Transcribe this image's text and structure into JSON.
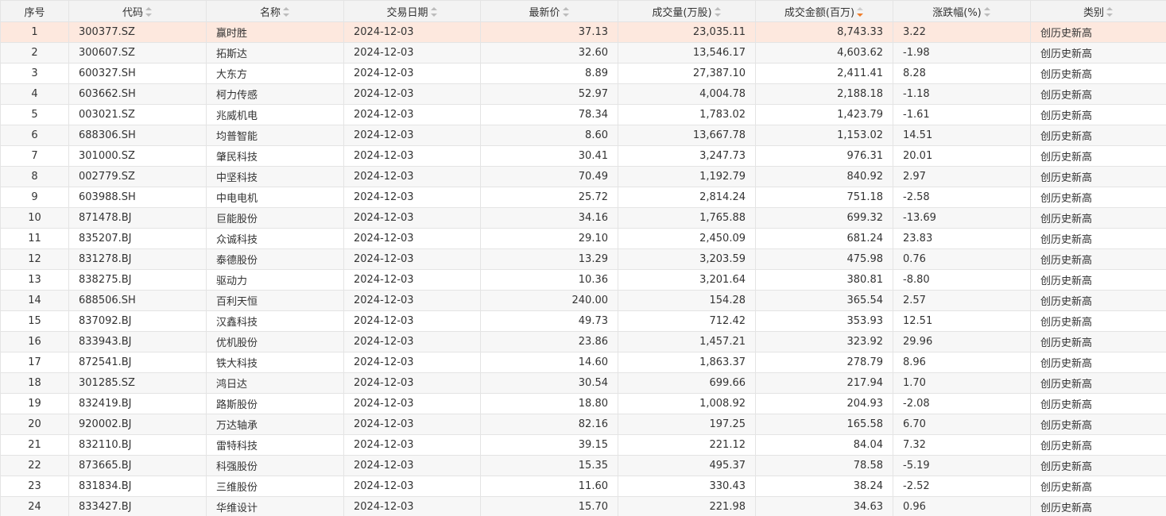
{
  "table": {
    "headers": {
      "seq": "序号",
      "code": "代码",
      "name": "名称",
      "date": "交易日期",
      "price": "最新价",
      "volume": "成交量(万股)",
      "amount": "成交金额(百万)",
      "pct": "涨跌幅(%)",
      "category": "类别"
    },
    "sort": {
      "column": "amount",
      "direction": "desc",
      "active_color": "#f07d2b"
    },
    "selected_row": 0,
    "rows": [
      [
        "1",
        "300377.SZ",
        "赢时胜",
        "2024-12-03",
        "37.13",
        "23,035.11",
        "8,743.33",
        "3.22",
        "创历史新高"
      ],
      [
        "2",
        "300607.SZ",
        "拓斯达",
        "2024-12-03",
        "32.60",
        "13,546.17",
        "4,603.62",
        "-1.98",
        "创历史新高"
      ],
      [
        "3",
        "600327.SH",
        "大东方",
        "2024-12-03",
        "8.89",
        "27,387.10",
        "2,411.41",
        "8.28",
        "创历史新高"
      ],
      [
        "4",
        "603662.SH",
        "柯力传感",
        "2024-12-03",
        "52.97",
        "4,004.78",
        "2,188.18",
        "-1.18",
        "创历史新高"
      ],
      [
        "5",
        "003021.SZ",
        "兆威机电",
        "2024-12-03",
        "78.34",
        "1,783.02",
        "1,423.79",
        "-1.61",
        "创历史新高"
      ],
      [
        "6",
        "688306.SH",
        "均普智能",
        "2024-12-03",
        "8.60",
        "13,667.78",
        "1,153.02",
        "14.51",
        "创历史新高"
      ],
      [
        "7",
        "301000.SZ",
        "肇民科技",
        "2024-12-03",
        "30.41",
        "3,247.73",
        "976.31",
        "20.01",
        "创历史新高"
      ],
      [
        "8",
        "002779.SZ",
        "中坚科技",
        "2024-12-03",
        "70.49",
        "1,192.79",
        "840.92",
        "2.97",
        "创历史新高"
      ],
      [
        "9",
        "603988.SH",
        "中电电机",
        "2024-12-03",
        "25.72",
        "2,814.24",
        "751.18",
        "-2.58",
        "创历史新高"
      ],
      [
        "10",
        "871478.BJ",
        "巨能股份",
        "2024-12-03",
        "34.16",
        "1,765.88",
        "699.32",
        "-13.69",
        "创历史新高"
      ],
      [
        "11",
        "835207.BJ",
        "众诚科技",
        "2024-12-03",
        "29.10",
        "2,450.09",
        "681.24",
        "23.83",
        "创历史新高"
      ],
      [
        "12",
        "831278.BJ",
        "泰德股份",
        "2024-12-03",
        "13.29",
        "3,203.59",
        "475.98",
        "0.76",
        "创历史新高"
      ],
      [
        "13",
        "838275.BJ",
        "驱动力",
        "2024-12-03",
        "10.36",
        "3,201.64",
        "380.81",
        "-8.80",
        "创历史新高"
      ],
      [
        "14",
        "688506.SH",
        "百利天恒",
        "2024-12-03",
        "240.00",
        "154.28",
        "365.54",
        "2.57",
        "创历史新高"
      ],
      [
        "15",
        "837092.BJ",
        "汉鑫科技",
        "2024-12-03",
        "49.73",
        "712.42",
        "353.93",
        "12.51",
        "创历史新高"
      ],
      [
        "16",
        "833943.BJ",
        "优机股份",
        "2024-12-03",
        "23.86",
        "1,457.21",
        "323.92",
        "29.96",
        "创历史新高"
      ],
      [
        "17",
        "872541.BJ",
        "铁大科技",
        "2024-12-03",
        "14.60",
        "1,863.37",
        "278.79",
        "8.96",
        "创历史新高"
      ],
      [
        "18",
        "301285.SZ",
        "鸿日达",
        "2024-12-03",
        "30.54",
        "699.66",
        "217.94",
        "1.70",
        "创历史新高"
      ],
      [
        "19",
        "832419.BJ",
        "路斯股份",
        "2024-12-03",
        "18.80",
        "1,008.92",
        "204.93",
        "-2.08",
        "创历史新高"
      ],
      [
        "20",
        "920002.BJ",
        "万达轴承",
        "2024-12-03",
        "82.16",
        "197.25",
        "165.58",
        "6.70",
        "创历史新高"
      ],
      [
        "21",
        "832110.BJ",
        "雷特科技",
        "2024-12-03",
        "39.15",
        "221.12",
        "84.04",
        "7.32",
        "创历史新高"
      ],
      [
        "22",
        "873665.BJ",
        "科强股份",
        "2024-12-03",
        "15.35",
        "495.37",
        "78.58",
        "-5.19",
        "创历史新高"
      ],
      [
        "23",
        "831834.BJ",
        "三维股份",
        "2024-12-03",
        "11.60",
        "330.43",
        "38.24",
        "-2.52",
        "创历史新高"
      ],
      [
        "24",
        "833427.BJ",
        "华维设计",
        "2024-12-03",
        "15.70",
        "221.98",
        "34.63",
        "0.96",
        "创历史新高"
      ]
    ]
  }
}
